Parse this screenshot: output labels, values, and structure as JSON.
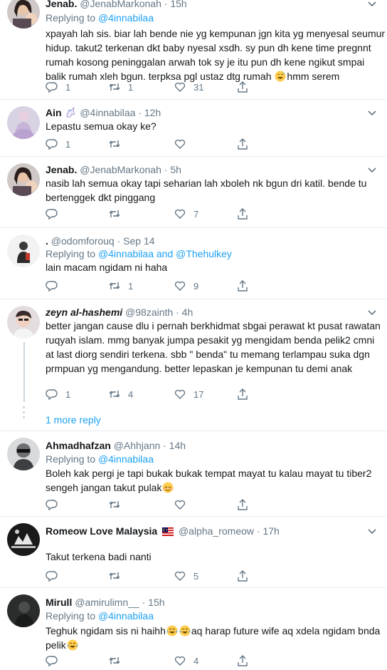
{
  "theme": {
    "accent": "#1da1f2",
    "muted": "#657786",
    "text": "#14171a",
    "divider": "#e6ecf0"
  },
  "tweets": [
    {
      "name": "Jenab.",
      "handle": "@JenabMarkonah",
      "sep": "·",
      "time": "15h",
      "replying_prefix": "Replying to",
      "replying_to": "@4innabilaa",
      "lines": [
        "xpayah lah sis. biar lah bende nie yg kempunan jgn kita yg menyesal seumur",
        "hidup. takut2 terkenan dkt baby nyesal xsdh. sy pun dh kene time pregnnt",
        "rumah kosong peninggalan arwah tok sy je itu pun dh kene ngikut smpai",
        "balik rumah xleh bgun. terpksa pgl ustaz dtg rumah"
      ],
      "line_after_emoji": "hmm serem",
      "reply_count": "1",
      "retweet_count": "1",
      "like_count": "31"
    },
    {
      "name": "Ain",
      "handle": "@4innabilaa",
      "sep": "·",
      "time": "12h",
      "lines": [
        "Lepastu semua okay ke?"
      ],
      "reply_count": "1",
      "retweet_count": "",
      "like_count": ""
    },
    {
      "name": "Jenab.",
      "handle": "@JenabMarkonah",
      "sep": "·",
      "time": "5h",
      "lines": [
        "nasib lah semua okay tapi seharian lah xboleh nk bgun dri katil. bende tu",
        "bertenggek dkt pinggang"
      ],
      "reply_count": "",
      "retweet_count": "",
      "like_count": "7"
    },
    {
      "name": ".",
      "handle": "@odomforouq",
      "sep": "·",
      "time": "Sep 14",
      "replying_prefix": "Replying to",
      "replying_to": "@4innabilaa",
      "replying_and": "and",
      "replying_to2": "@Thehulkey",
      "lines": [
        "lain macam ngidam ni haha"
      ],
      "reply_count": "",
      "retweet_count": "1",
      "like_count": "9"
    },
    {
      "name": "zeyn al-hashemi",
      "handle": "@98zainth",
      "sep": "·",
      "time": "4h",
      "lines": [
        "better jangan cause dlu i pernah berkhidmat sbgai perawat kt pusat rawatan",
        "ruqyah islam. mmg banyak jumpa pesakit yg mengidam benda pelik2 cmni",
        "at last diorg sendiri terkena. sbb \" benda\" tu memang terlampau suka dgn",
        "prmpuan yg mengandung. better lepaskan je kempunan tu demi anak"
      ],
      "reply_count": "1",
      "retweet_count": "4",
      "like_count": "17",
      "more_replies": "1 more reply"
    },
    {
      "name": "Ahmadhafzan",
      "handle": "@Ahhjann",
      "sep": "·",
      "time": "14h",
      "replying_prefix": "Replying to",
      "replying_to": "@4innabilaa",
      "lines": [
        "Boleh kak pergi je tapi bukak bukak tempat mayat tu kalau mayat tu tiber2",
        "sengeh jangan takut pulak"
      ],
      "reply_count": "",
      "retweet_count": "",
      "like_count": ""
    },
    {
      "name": "Romeow Love Malaysia",
      "handle": "@alpha_romeow",
      "sep": "·",
      "time": "17h",
      "lines": [
        "Takut terkena badi nanti"
      ],
      "reply_count": "",
      "retweet_count": "",
      "like_count": "5"
    },
    {
      "name": "Mirull",
      "handle": "@amirulimn__",
      "sep": "·",
      "time": "15h",
      "replying_prefix": "Replying to",
      "replying_to": "@4innabilaa",
      "line1_a": "Teghuk ngidam sis ni haihh",
      "line1_b": "aq harap future wife aq xdela ngidam bnda",
      "line2_a": "pelik",
      "reply_count": "",
      "retweet_count": "",
      "like_count": "4"
    }
  ],
  "icons": {
    "reply": "reply-icon",
    "retweet": "retweet-icon",
    "like": "heart-icon",
    "share": "share-icon",
    "caret": "chevron-down-icon",
    "flag": "malaysia-flag-icon",
    "unicorn": "unicorn-emoji-icon"
  }
}
